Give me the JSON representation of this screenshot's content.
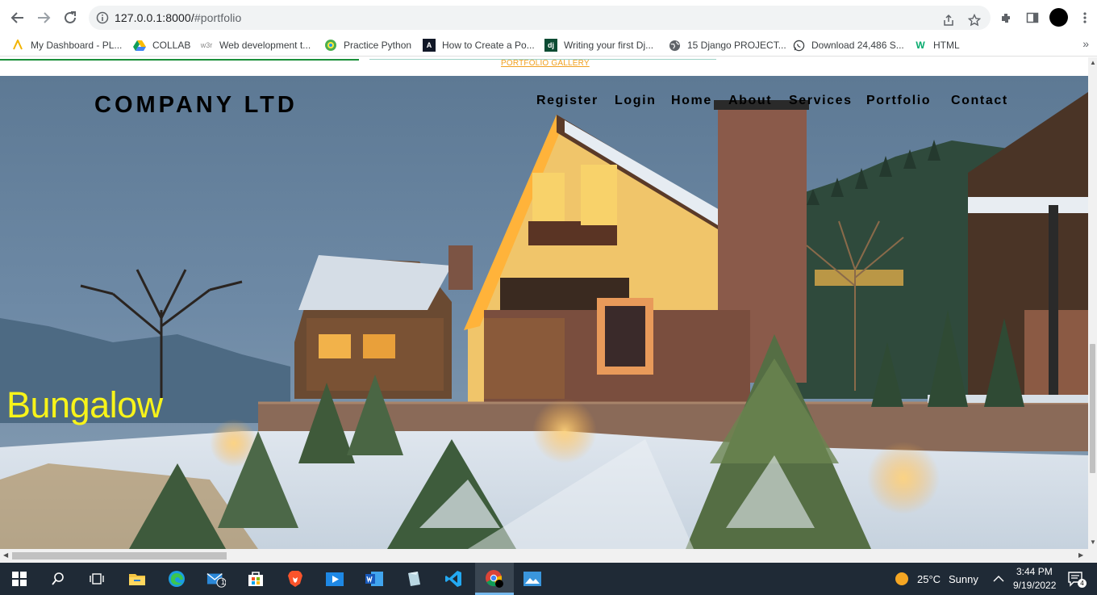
{
  "browser": {
    "url_host": "127.0.0.1:8000/",
    "url_path": "#portfolio",
    "bookmarks": [
      {
        "label": "My Dashboard - PL...",
        "icon": "dashboard-bookmark-icon"
      },
      {
        "label": "COLLAB",
        "icon": "google-drive-icon"
      },
      {
        "label": "Web development t...",
        "icon": "w3schools-icon"
      },
      {
        "label": "Practice Python",
        "icon": "python-icon"
      },
      {
        "label": "How to Create a Po...",
        "icon": "site-icon"
      },
      {
        "label": "Writing your first Dj...",
        "icon": "django-icon"
      },
      {
        "label": "15 Django PROJECT...",
        "icon": "globe-icon"
      },
      {
        "label": "Download 24,486 S...",
        "icon": "whatsapp-icon"
      },
      {
        "label": "HTML",
        "icon": "w3-green-icon"
      }
    ],
    "more_bookmarks": "»"
  },
  "page": {
    "gallery_link": "PORTFOLIO GALLERY",
    "brand": "COMPANY LTD",
    "nav": [
      "Register",
      "Login",
      "Home",
      "About",
      "Services",
      "Portfolio",
      "Contact"
    ],
    "slide_caption": "Bungalow",
    "caption_color": "#f7f31a"
  },
  "taskbar": {
    "weather_temp": "25°C",
    "weather_text": "Sunny",
    "time": "3:44 PM",
    "date": "9/19/2022",
    "mail_badge": "1",
    "notification_badge": "4"
  }
}
